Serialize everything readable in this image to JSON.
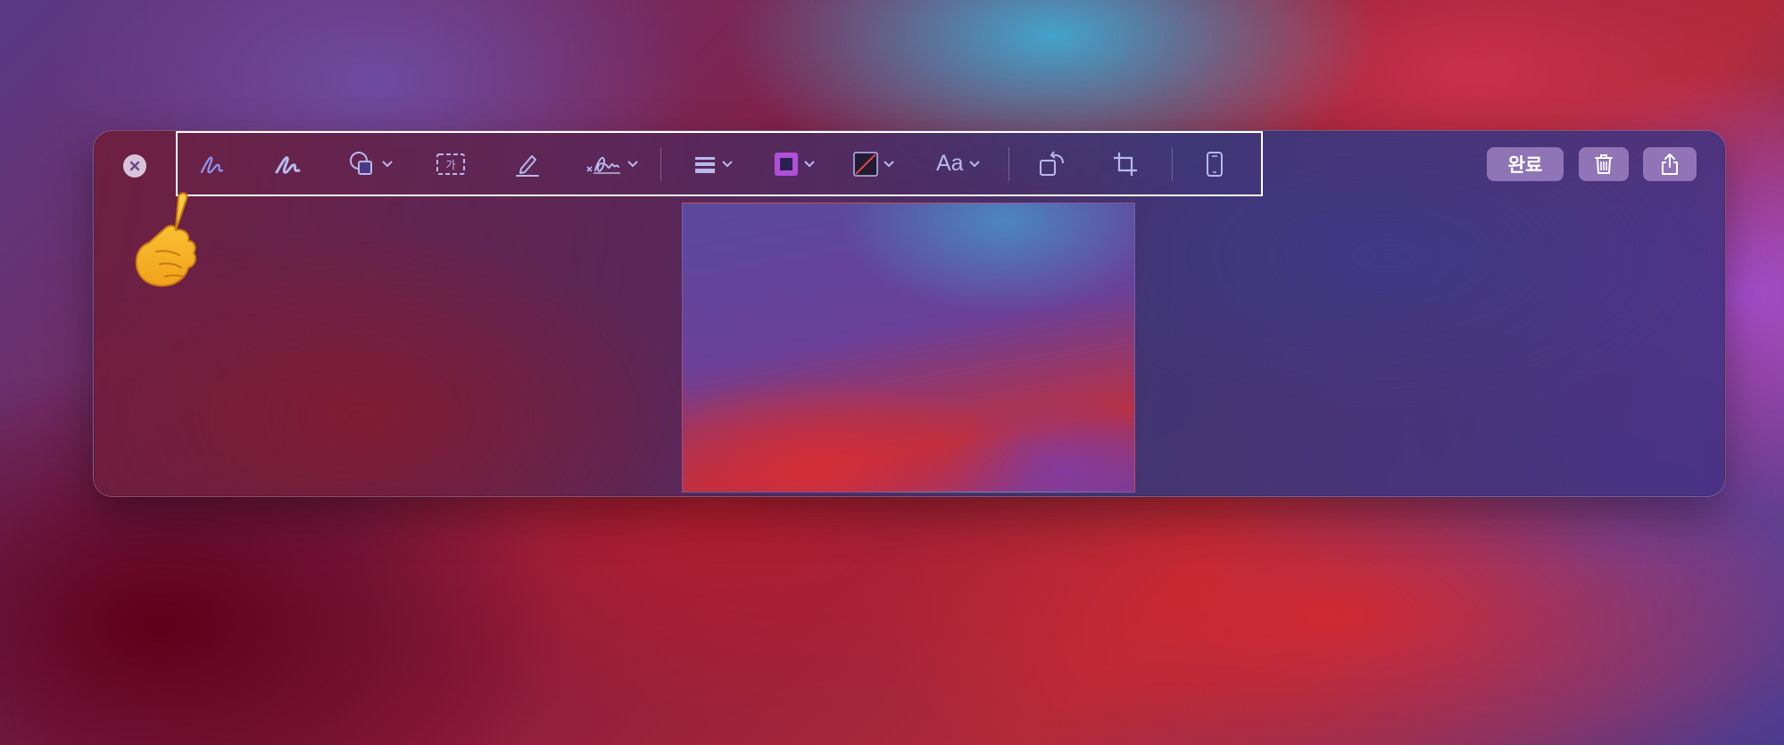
{
  "window": {
    "close_button": {
      "icon": "close-icon"
    }
  },
  "toolbar": {
    "highlighted": true,
    "tools": [
      {
        "name": "sketch",
        "icon": "sketch-icon",
        "active": true
      },
      {
        "name": "draw",
        "icon": "draw-icon"
      },
      {
        "name": "shapes",
        "icon": "shapes-icon",
        "has_menu": true
      },
      {
        "name": "text",
        "icon": "text-box-icon",
        "glyph": "가"
      },
      {
        "name": "highlight",
        "icon": "pencil-underline-icon"
      },
      {
        "name": "sign",
        "icon": "signature-icon",
        "has_menu": true
      },
      {
        "name": "shape_style",
        "icon": "line-weight-icon",
        "has_menu": true
      },
      {
        "name": "border_color",
        "icon": "border-color-icon",
        "has_menu": true,
        "color": "#b04fd8"
      },
      {
        "name": "fill_color",
        "icon": "fill-color-icon",
        "has_menu": true,
        "color": "#e0453c"
      },
      {
        "name": "text_style",
        "icon": "text-style-icon",
        "label": "Aa",
        "has_menu": true
      },
      {
        "name": "rotate",
        "icon": "rotate-icon"
      },
      {
        "name": "crop",
        "icon": "crop-icon"
      },
      {
        "name": "device",
        "icon": "phone-icon"
      }
    ]
  },
  "actions": {
    "done_label": "완료",
    "trash_icon": "trash-icon",
    "share_icon": "share-icon"
  },
  "colors": {
    "accent": "#8d95f5",
    "icon": "#b7b9ee",
    "highlight_border": "#ffffff"
  },
  "pointer": {
    "icon": "pointing-hand-icon"
  }
}
